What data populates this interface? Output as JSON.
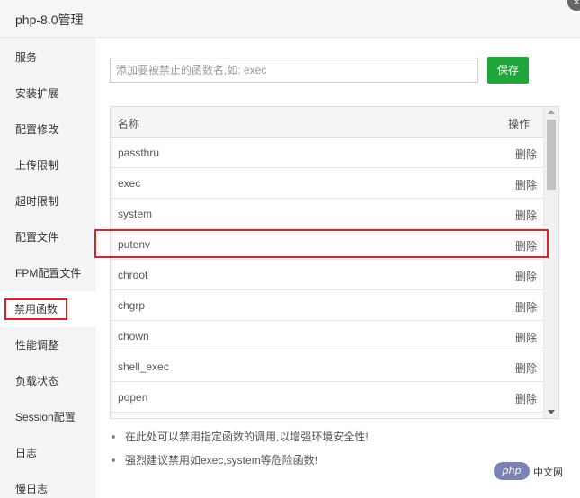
{
  "window": {
    "title": "php-8.0管理",
    "close_icon": "×"
  },
  "sidebar": {
    "items": [
      {
        "label": "服务"
      },
      {
        "label": "安装扩展"
      },
      {
        "label": "配置修改"
      },
      {
        "label": "上传限制"
      },
      {
        "label": "超时限制"
      },
      {
        "label": "配置文件"
      },
      {
        "label": "FPM配置文件"
      },
      {
        "label": "禁用函数",
        "active": true
      },
      {
        "label": "性能调整"
      },
      {
        "label": "负载状态"
      },
      {
        "label": "Session配置"
      },
      {
        "label": "日志"
      },
      {
        "label": "慢日志"
      }
    ]
  },
  "form": {
    "placeholder": "添加要被禁止的函数名,如: exec",
    "save_label": "保存",
    "save_color": "#20a53a"
  },
  "table": {
    "headers": {
      "name": "名称",
      "op": "操作"
    },
    "rows": [
      {
        "name": "passthru",
        "action": "删除"
      },
      {
        "name": "exec",
        "action": "删除"
      },
      {
        "name": "system",
        "action": "删除"
      },
      {
        "name": "putenv",
        "action": "删除",
        "highlighted": true
      },
      {
        "name": "chroot",
        "action": "删除"
      },
      {
        "name": "chgrp",
        "action": "删除"
      },
      {
        "name": "chown",
        "action": "删除"
      },
      {
        "name": "shell_exec",
        "action": "删除"
      },
      {
        "name": "popen",
        "action": "删除"
      }
    ]
  },
  "tips": [
    "在此处可以禁用指定函数的调用,以增强环境安全性!",
    "强烈建议禁用如exec,system等危险函数!"
  ],
  "watermark": {
    "logo": "php",
    "text": "中文网"
  },
  "colors": {
    "accent_green": "#20a53a",
    "highlight_red": "#d9232c"
  }
}
